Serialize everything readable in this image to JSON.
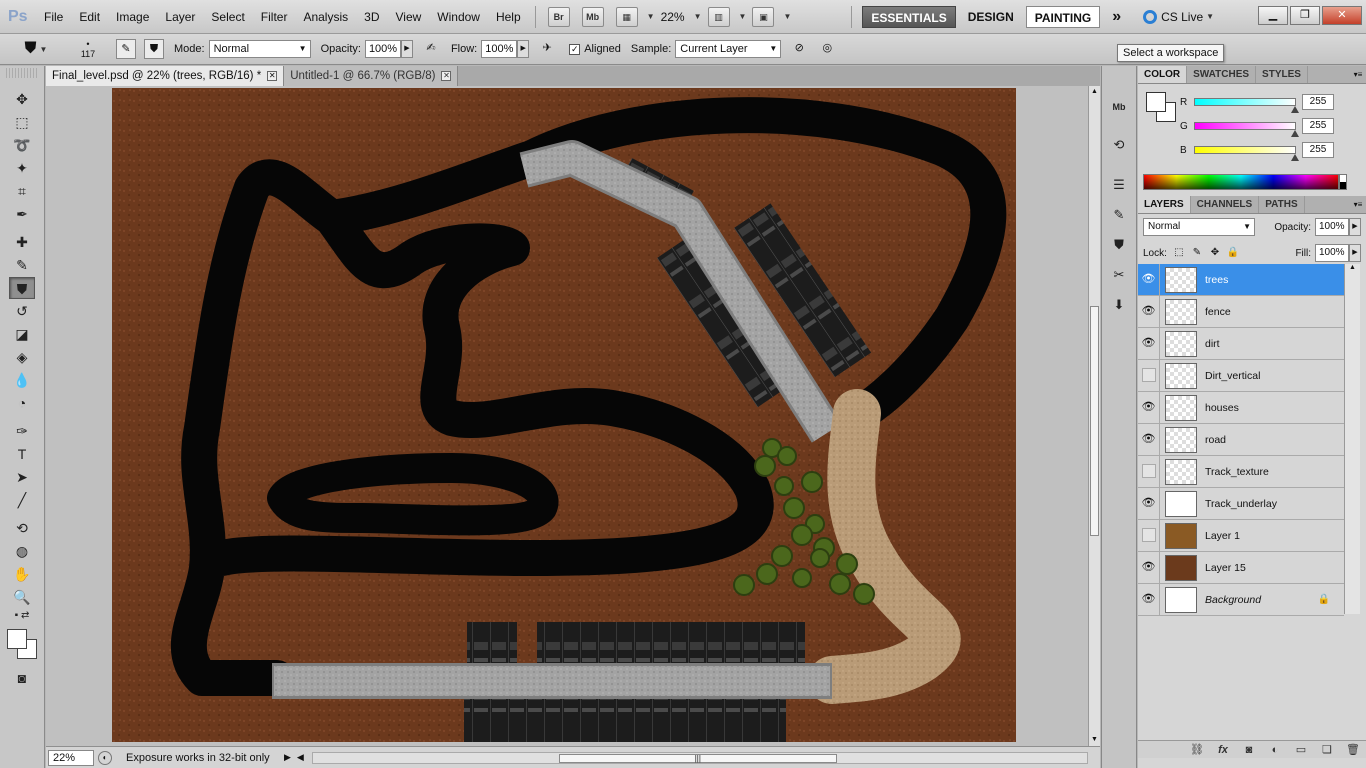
{
  "app": {
    "logo": "Ps"
  },
  "menu": [
    "File",
    "Edit",
    "Image",
    "Layer",
    "Select",
    "Filter",
    "Analysis",
    "3D",
    "View",
    "Window",
    "Help"
  ],
  "menubar_buttons": {
    "bridge": "Br",
    "minibridge": "Mb",
    "zoom": "22%"
  },
  "workspaces": {
    "essentials": "ESSENTIALS",
    "design": "DESIGN",
    "painting": "PAINTING",
    "more": "»"
  },
  "cslive": "CS Live",
  "tooltip": "Select a workspace",
  "options": {
    "brush_size": "117",
    "mode_label": "Mode:",
    "mode_value": "Normal",
    "opacity_label": "Opacity:",
    "opacity_value": "100%",
    "flow_label": "Flow:",
    "flow_value": "100%",
    "aligned_label": "Aligned",
    "sample_label": "Sample:",
    "sample_value": "Current Layer"
  },
  "tabs": [
    {
      "label": "Final_level.psd @ 22% (trees, RGB/16) *"
    },
    {
      "label": "Untitled-1 @ 66.7% (RGB/8)"
    }
  ],
  "status": {
    "zoom": "22%",
    "message": "Exposure works in 32-bit only"
  },
  "color_panel": {
    "tabs": [
      "COLOR",
      "SWATCHES",
      "STYLES"
    ],
    "r_label": "R",
    "g_label": "G",
    "b_label": "B",
    "r": "255",
    "g": "255",
    "b": "255"
  },
  "layers_panel": {
    "tabs": [
      "LAYERS",
      "CHANNELS",
      "PATHS"
    ],
    "blend_mode": "Normal",
    "opacity_label": "Opacity:",
    "opacity": "100%",
    "lock_label": "Lock:",
    "fill_label": "Fill:",
    "fill": "100%",
    "layers": [
      {
        "name": "trees",
        "visible": true,
        "selected": true
      },
      {
        "name": "fence",
        "visible": true
      },
      {
        "name": "dirt",
        "visible": true
      },
      {
        "name": "Dirt_vertical",
        "visible": false
      },
      {
        "name": "houses",
        "visible": true
      },
      {
        "name": "road",
        "visible": true
      },
      {
        "name": "Track_texture",
        "visible": false
      },
      {
        "name": "Track_underlay",
        "visible": true
      },
      {
        "name": "Layer 1",
        "visible": false
      },
      {
        "name": "Layer 15",
        "visible": true
      },
      {
        "name": "Background",
        "visible": true,
        "locked": true
      }
    ]
  },
  "colors": {
    "accent": "#3a8fe8",
    "ground": "#6e3a1e",
    "track": "#050505",
    "road": "#9c9c9c",
    "dirt_path": "#b89a76",
    "trees": "#4d6a1e"
  }
}
